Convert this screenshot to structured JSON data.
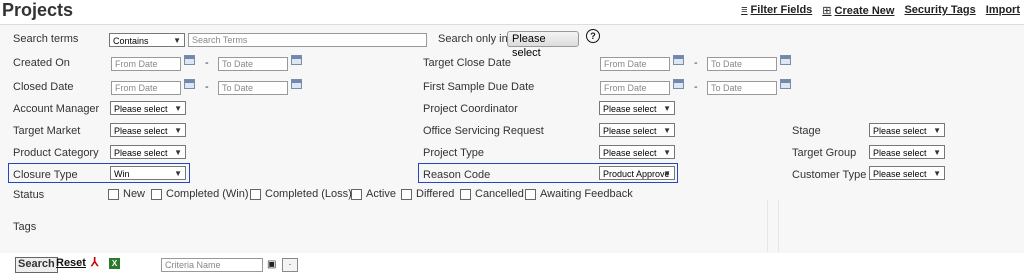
{
  "title": "Projects",
  "toplinks": {
    "filter_fields": "Filter Fields",
    "create_new": "Create New",
    "security_tags": "Security Tags",
    "import": "Import"
  },
  "labels": {
    "search_terms": "Search terms",
    "created_on": "Created On",
    "closed_date": "Closed Date",
    "account_manager": "Account Manager",
    "target_market": "Target Market",
    "product_category": "Product Category",
    "closure_type": "Closure Type",
    "status": "Status",
    "tags": "Tags",
    "search_only_in": "Search only in",
    "target_close_date": "Target Close Date",
    "first_sample_due_date": "First Sample Due Date",
    "project_coordinator": "Project Coordinator",
    "office_servicing_request": "Office Servicing Request",
    "project_type": "Project Type",
    "reason_code": "Reason Code",
    "stage": "Stage",
    "target_group": "Target Group",
    "customer_type": "Customer Type"
  },
  "values": {
    "contains": "Contains",
    "search_placeholder": "Search Terms",
    "from_date": "From Date",
    "to_date": "To Date",
    "please_select": "Please select",
    "closure_type": "Win",
    "reason_code": "Product Approve",
    "criteria_placeholder": "Criteria Name"
  },
  "buttons": {
    "search_only_in": "Please select",
    "search": "Search",
    "reset": "Reset",
    "help": "?"
  },
  "statuses": [
    "New",
    "Completed (Win)",
    "Completed (Loss)",
    "Active",
    "Differed",
    "Cancelled",
    "Awaiting Feedback"
  ],
  "colors": {
    "highlight": "#2346c8",
    "pdf": "#cc0000",
    "excel": "#2c7a2c"
  },
  "icons": [
    "filter-icon",
    "plus-icon",
    "calendar-icon",
    "help-icon",
    "pdf-icon",
    "excel-icon",
    "save-icon",
    "chevron-down-icon"
  ]
}
